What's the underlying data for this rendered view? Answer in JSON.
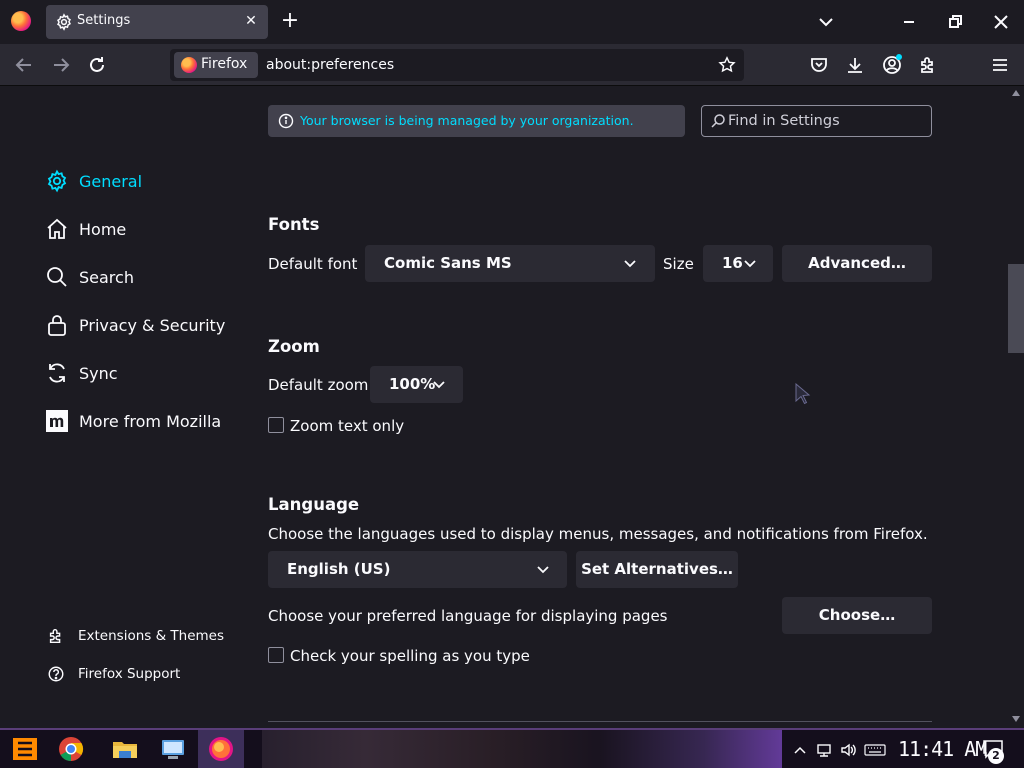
{
  "tab": {
    "title": "Settings",
    "close": "✕"
  },
  "toolbar": {
    "new_tab": "+"
  },
  "urlbar": {
    "identity_label": "Firefox",
    "url": "about:preferences"
  },
  "policy_notice": "Your browser is being managed by your organization.",
  "search": {
    "placeholder": "Find in Settings"
  },
  "sidebar": {
    "categories": [
      {
        "label": "General",
        "icon": "gear-icon",
        "selected": true
      },
      {
        "label": "Home",
        "icon": "home-icon"
      },
      {
        "label": "Search",
        "icon": "search-icon"
      },
      {
        "label": "Privacy & Security",
        "icon": "lock-icon"
      },
      {
        "label": "Sync",
        "icon": "sync-icon"
      },
      {
        "label": "More from Mozilla",
        "icon": "mozilla-icon"
      }
    ],
    "footer": [
      {
        "label": "Extensions & Themes",
        "icon": "puzzle-icon"
      },
      {
        "label": "Firefox Support",
        "icon": "help-icon"
      }
    ]
  },
  "fonts": {
    "heading": "Fonts",
    "default_font_label": "Default font",
    "default_font_value": "Comic Sans MS",
    "size_label": "Size",
    "size_value": "16",
    "advanced_button": "Advanced…"
  },
  "zoom": {
    "heading": "Zoom",
    "default_zoom_label": "Default zoom",
    "default_zoom_value": "100%",
    "zoom_text_only_label": "Zoom text only",
    "zoom_text_only_checked": false
  },
  "language": {
    "heading": "Language",
    "description": "Choose the languages used to display menus, messages, and notifications from Firefox.",
    "selected_language": "English (US)",
    "set_alternatives_button": "Set Alternatives…",
    "page_language_label": "Choose your preferred language for displaying pages",
    "choose_button": "Choose…",
    "spellcheck_label": "Check your spelling as you type",
    "spellcheck_checked": false
  },
  "taskbar": {
    "clock": "11:41 AM",
    "notification_count": "2"
  },
  "colors": {
    "accent": "#00ddff",
    "background": "#1c1b22",
    "surface": "#2b2a33",
    "text": "#fbfbfe"
  }
}
